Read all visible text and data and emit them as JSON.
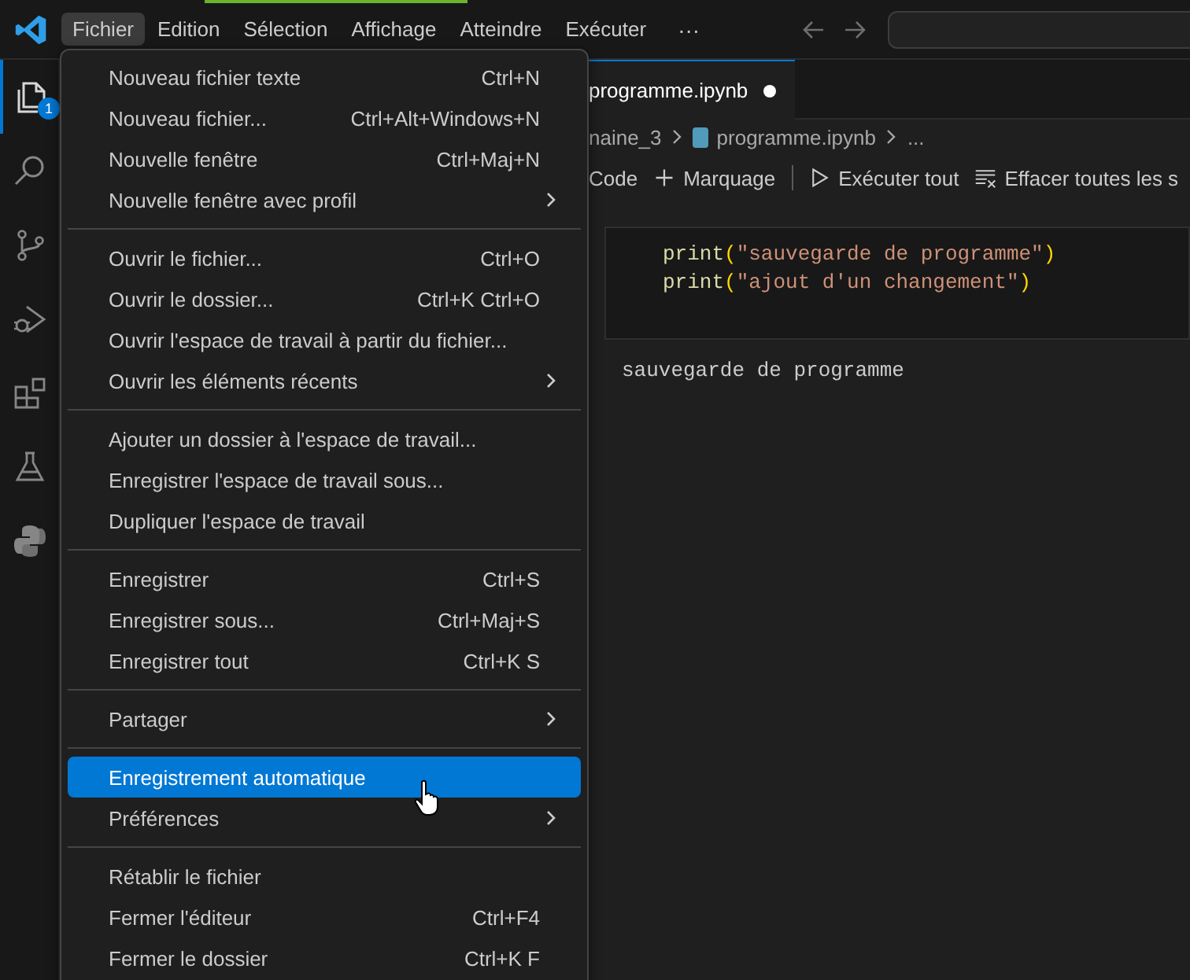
{
  "title_bar": {
    "menus": [
      {
        "label": "Fichier",
        "selected": true
      },
      {
        "label": "Edition",
        "selected": false
      },
      {
        "label": "Sélection",
        "selected": false
      },
      {
        "label": "Affichage",
        "selected": false
      },
      {
        "label": "Atteindre",
        "selected": false
      },
      {
        "label": "Exécuter",
        "selected": false
      }
    ],
    "more": "···"
  },
  "activity_bar": {
    "items": [
      {
        "kind": "files",
        "selected": true,
        "badge": "1"
      },
      {
        "kind": "search",
        "selected": false
      },
      {
        "kind": "branch",
        "selected": false
      },
      {
        "kind": "debug",
        "selected": false
      },
      {
        "kind": "blocks",
        "selected": false
      },
      {
        "kind": "flask",
        "selected": false
      },
      {
        "kind": "python",
        "selected": false
      }
    ]
  },
  "editor": {
    "tab": {
      "label": "programme.ipynb",
      "modified": true
    },
    "breadcrumb": [
      {
        "label": "naine_3",
        "file_icon": false
      },
      {
        "label": "programme.ipynb",
        "file_icon": true
      },
      {
        "label": "...",
        "file_icon": false
      }
    ],
    "toolbar": [
      {
        "kind": "text",
        "label": "Code"
      },
      {
        "kind": "add",
        "label": "Marquage"
      },
      {
        "kind": "run",
        "label": "Exécuter tout"
      },
      {
        "kind": "clear",
        "label": "Effacer toutes les s"
      }
    ],
    "cell": {
      "lines": [
        [
          {
            "text": "print",
            "kind": "function"
          },
          {
            "text": "(",
            "kind": "bracket"
          },
          {
            "text": "\"sauvegarde de programme\"",
            "kind": "string"
          },
          {
            "text": ")",
            "kind": "bracket"
          }
        ],
        [
          {
            "text": "print",
            "kind": "function"
          },
          {
            "text": "(",
            "kind": "bracket"
          },
          {
            "text": "\"ajout d'un changement\"",
            "kind": "string"
          },
          {
            "text": ")",
            "kind": "bracket"
          }
        ]
      ]
    },
    "output": "sauvegarde de programme"
  },
  "menu": {
    "sections": [
      [
        {
          "label": "Nouveau fichier texte",
          "shortcut": "Ctrl+N",
          "submenu": false,
          "selected": false
        },
        {
          "label": "Nouveau fichier...",
          "shortcut": "Ctrl+Alt+Windows+N",
          "submenu": false,
          "selected": false
        },
        {
          "label": "Nouvelle fenêtre",
          "shortcut": "Ctrl+Maj+N",
          "submenu": false,
          "selected": false
        },
        {
          "label": "Nouvelle fenêtre avec profil",
          "submenu": true,
          "selected": false
        }
      ],
      [
        {
          "label": "Ouvrir le fichier...",
          "shortcut": "Ctrl+O",
          "submenu": false,
          "selected": false
        },
        {
          "label": "Ouvrir le dossier...",
          "shortcut": "Ctrl+K Ctrl+O",
          "submenu": false,
          "selected": false
        },
        {
          "label": "Ouvrir l'espace de travail à partir du fichier...",
          "submenu": false,
          "selected": false
        },
        {
          "label": "Ouvrir les éléments récents",
          "submenu": true,
          "selected": false
        }
      ],
      [
        {
          "label": "Ajouter un dossier à l'espace de travail...",
          "submenu": false,
          "selected": false
        },
        {
          "label": "Enregistrer l'espace de travail sous...",
          "submenu": false,
          "selected": false
        },
        {
          "label": "Dupliquer l'espace de travail",
          "submenu": false,
          "selected": false
        }
      ],
      [
        {
          "label": "Enregistrer",
          "shortcut": "Ctrl+S",
          "submenu": false,
          "selected": false
        },
        {
          "label": "Enregistrer sous...",
          "shortcut": "Ctrl+Maj+S",
          "submenu": false,
          "selected": false
        },
        {
          "label": "Enregistrer tout",
          "shortcut": "Ctrl+K S",
          "submenu": false,
          "selected": false
        }
      ],
      [
        {
          "label": "Partager",
          "submenu": true,
          "selected": false
        }
      ],
      [
        {
          "label": "Enregistrement automatique",
          "submenu": false,
          "selected": true
        },
        {
          "label": "Préférences",
          "submenu": true,
          "selected": false
        }
      ],
      [
        {
          "label": "Rétablir le fichier",
          "submenu": false,
          "selected": false
        },
        {
          "label": "Fermer l'éditeur",
          "shortcut": "Ctrl+F4",
          "submenu": false,
          "selected": false
        },
        {
          "label": "Fermer le dossier",
          "shortcut": "Ctrl+K F",
          "submenu": false,
          "selected": false
        }
      ]
    ]
  }
}
